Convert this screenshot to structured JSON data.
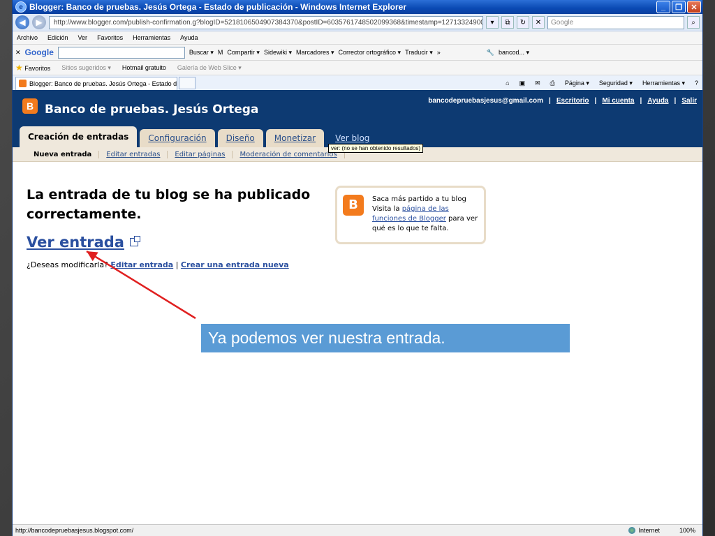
{
  "window": {
    "title": "Blogger: Banco de pruebas. Jesús Ortega - Estado de publicación - Windows Internet Explorer",
    "controls": [
      "_",
      "❐",
      "✕"
    ]
  },
  "address": {
    "url": "http://www.blogger.com/publish-confirmation.g?blogID=5218106504907384370&postID=6035761748502099368&timestamp=1271332490006&javascriptEnabl",
    "search_placeholder": "Google"
  },
  "menu": [
    "Archivo",
    "Edición",
    "Ver",
    "Favoritos",
    "Herramientas",
    "Ayuda"
  ],
  "googlebar": {
    "logo": "Google",
    "items": [
      "Buscar ▾",
      "Compartir ▾",
      "Sidewiki ▾",
      "Marcadores ▾",
      "Corrector ortográfico ▾",
      "Traducir ▾",
      "»",
      "bancod... ▾"
    ]
  },
  "favorites": {
    "label": "Favoritos",
    "items": [
      "Sitios sugeridos ▾",
      "Hotmail gratuito",
      "Galería de Web Slice ▾"
    ]
  },
  "tab": {
    "label": "Blogger: Banco de pruebas. Jesús Ortega - Estado de...",
    "commands": [
      "Página ▾",
      "Seguridad ▾",
      "Herramientas ▾"
    ]
  },
  "blogger": {
    "blog_title": "Banco de pruebas. Jesús Ortega",
    "user_email": "bancodepruebasjesus@gmail.com",
    "user_links": [
      "Escritorio",
      "Mi cuenta",
      "Ayuda",
      "Salir"
    ],
    "tabs": [
      "Creación de entradas",
      "Configuración",
      "Diseño",
      "Monetizar",
      "Ver blog"
    ],
    "subtabs": [
      "Nueva entrada",
      "Editar entradas",
      "Editar páginas",
      "Moderación de comentarios"
    ],
    "tooltip": "ver: (no se han obtenido resultados)",
    "confirm_title": "La entrada de tu blog se ha publicado correctamente.",
    "view_post": "Ver entrada",
    "modify_prompt": "¿Deseas modificarla?",
    "edit_post": "Editar entrada",
    "separator": "|",
    "new_post": "Crear una entrada nueva",
    "promo_line1": "Saca más partido a tu blog",
    "promo_line2": "Visita la ",
    "promo_link": "página de las funciones de Blogger",
    "promo_line3": " para ver qué es lo que te falta."
  },
  "status": {
    "url": "http://bancodepruebasjesus.blogspot.com/",
    "zone": "Internet",
    "zoom": "100%"
  },
  "annotation": {
    "callout": "Ya podemos ver nuestra entrada.",
    "arrow_color": "#e02020"
  }
}
